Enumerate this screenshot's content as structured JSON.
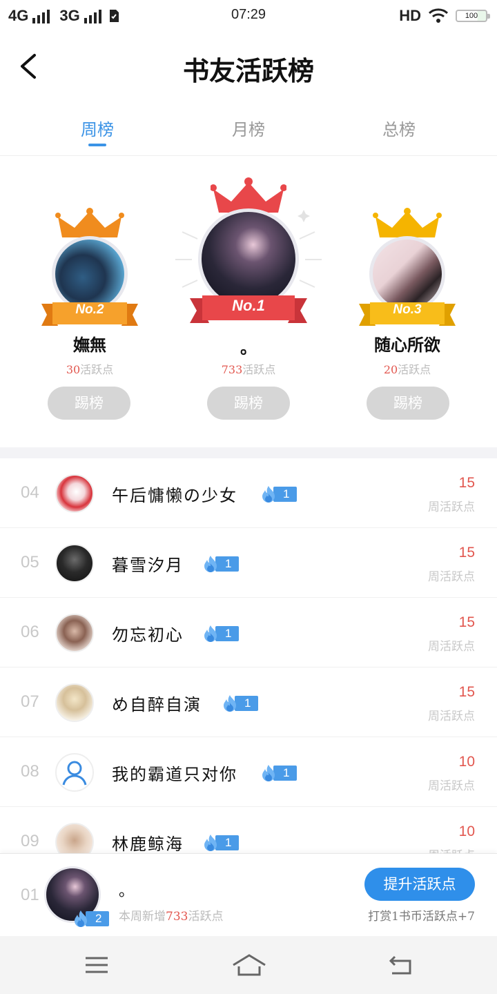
{
  "status_bar": {
    "signal_1": "4G",
    "signal_2": "3G",
    "time": "07:29",
    "hd": "HD",
    "battery": "100"
  },
  "header": {
    "title": "书友活跃榜"
  },
  "tabs": [
    {
      "label": "周榜",
      "active": true
    },
    {
      "label": "月榜",
      "active": false
    },
    {
      "label": "总榜",
      "active": false
    }
  ],
  "podium": {
    "first": {
      "ribbon": "No.1",
      "name": "。",
      "points": "733",
      "unit": "活跃点",
      "button": "踢榜"
    },
    "second": {
      "ribbon": "No.2",
      "name": "嫵無",
      "points": "30",
      "unit": "活跃点",
      "button": "踢榜"
    },
    "third": {
      "ribbon": "No.3",
      "name": "随心所欲",
      "points": "20",
      "unit": "活跃点",
      "button": "踢榜"
    }
  },
  "list": [
    {
      "rank": "04",
      "name": "午后慵懒の少女",
      "badge": "1",
      "value": "15",
      "unit": "周活跃点"
    },
    {
      "rank": "05",
      "name": "暮雪汐月",
      "badge": "1",
      "value": "15",
      "unit": "周活跃点"
    },
    {
      "rank": "06",
      "name": "勿忘初心",
      "badge": "1",
      "value": "15",
      "unit": "周活跃点"
    },
    {
      "rank": "07",
      "name": "め自醉自演",
      "badge": "1",
      "value": "15",
      "unit": "周活跃点"
    },
    {
      "rank": "08",
      "name": "我的霸道只对你",
      "badge": "1",
      "value": "10",
      "unit": "周活跃点"
    },
    {
      "rank": "09",
      "name": "林鹿鲸海",
      "badge": "1",
      "value": "10",
      "unit": "周活跃点"
    }
  ],
  "my": {
    "rank": "01",
    "badge": "2",
    "name": "。",
    "note_prefix": "本周新增",
    "note_points": "733",
    "note_suffix": "活跃点",
    "button": "提升活跃点",
    "reward_note": "打赏1书币活跃点+7"
  },
  "colors": {
    "accent": "#3b93e6",
    "points_red": "#e2574f",
    "gold": "#f5b400",
    "orange": "#f08c1e",
    "crown_red": "#e8474a"
  }
}
